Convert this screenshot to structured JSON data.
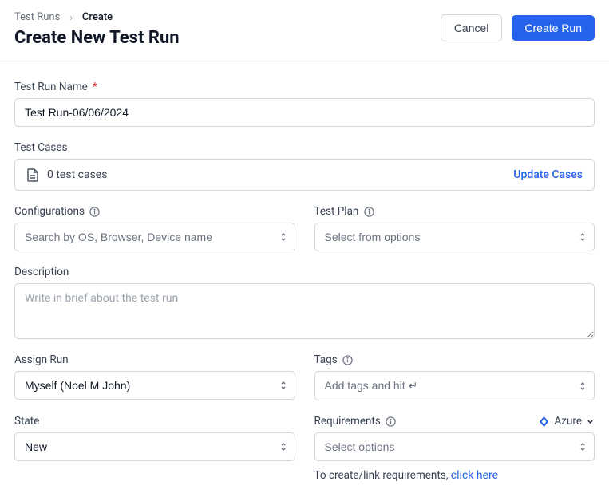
{
  "breadcrumb": {
    "parent": "Test Runs",
    "current": "Create"
  },
  "header": {
    "title": "Create New Test Run",
    "cancel_label": "Cancel",
    "create_label": "Create Run"
  },
  "form": {
    "name": {
      "label": "Test Run Name",
      "required": true,
      "value": "Test Run-06/06/2024"
    },
    "test_cases": {
      "label": "Test Cases",
      "count_text": "0 test cases",
      "update_label": "Update Cases"
    },
    "configurations": {
      "label": "Configurations",
      "placeholder": "Search by OS, Browser, Device name"
    },
    "test_plan": {
      "label": "Test Plan",
      "placeholder": "Select from options"
    },
    "description": {
      "label": "Description",
      "placeholder": "Write in brief about the test run"
    },
    "assign": {
      "label": "Assign Run",
      "value": "Myself (Noel M John)"
    },
    "tags": {
      "label": "Tags",
      "placeholder": "Add tags and hit ↵"
    },
    "state": {
      "label": "State",
      "value": "New"
    },
    "requirements": {
      "label": "Requirements",
      "integration": "Azure",
      "placeholder": "Select options",
      "helper_prefix": "To create/link requirements, ",
      "helper_link": "click here"
    }
  }
}
